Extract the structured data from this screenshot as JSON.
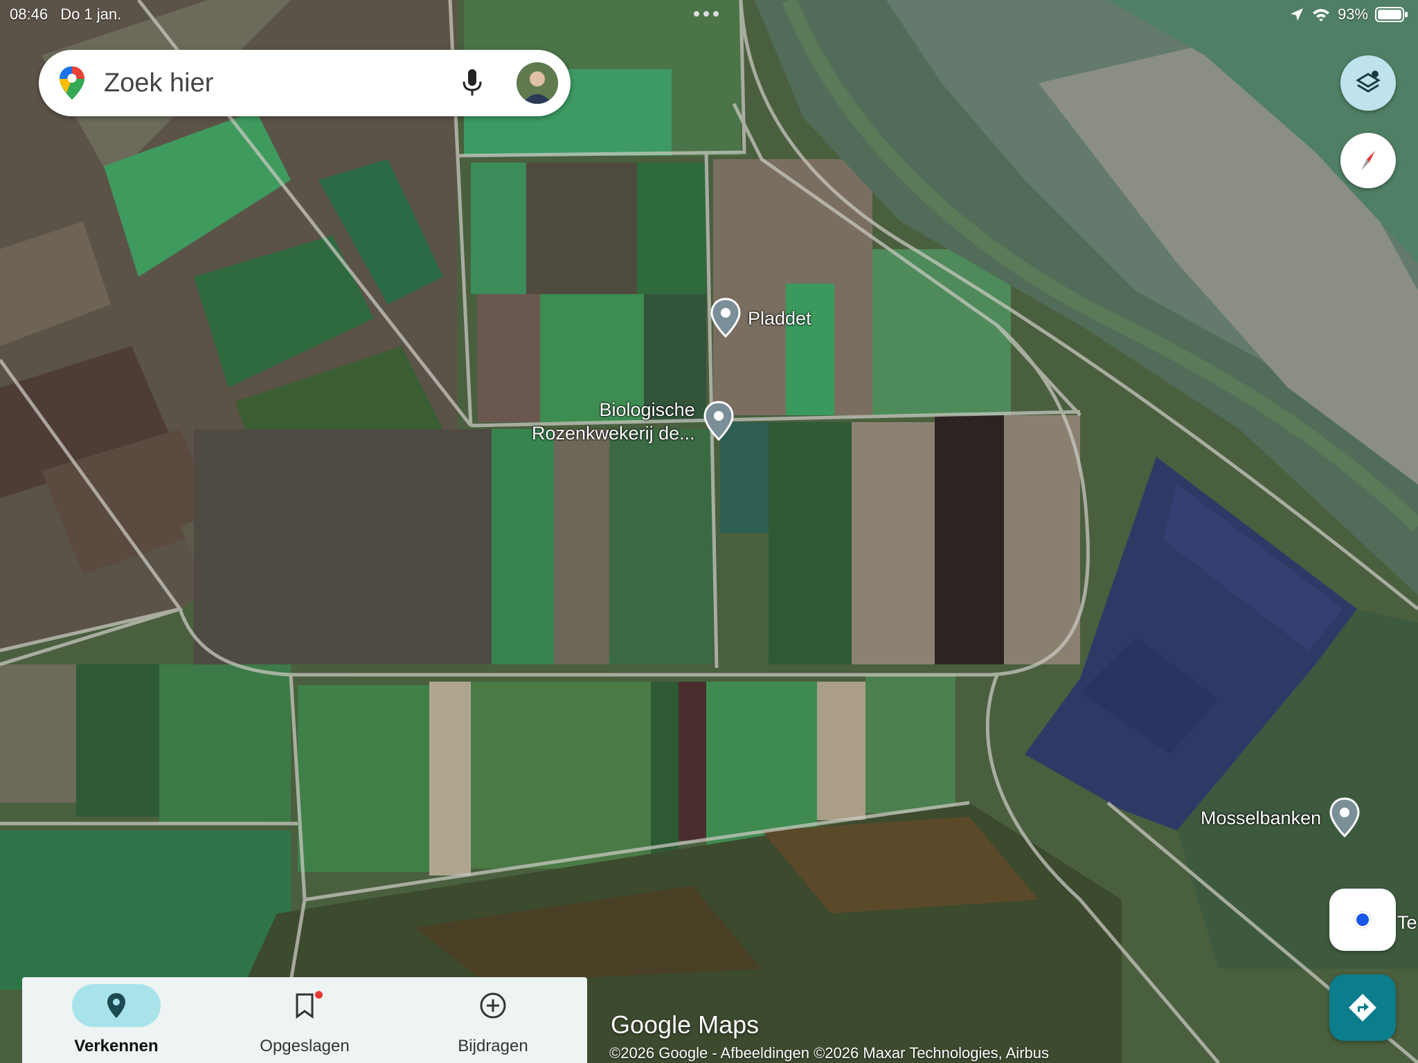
{
  "status_bar": {
    "time": "08:46",
    "date": "Do 1 jan.",
    "battery": "93%"
  },
  "search": {
    "placeholder": "Zoek hier"
  },
  "places": {
    "pladdet": "Pladdet",
    "rozen_line1": "Biologische",
    "rozen_line2": "Rozenkwekerij de...",
    "mosselbanken": "Mosselbanken",
    "edge": "Te"
  },
  "nav": [
    {
      "label": "Verkennen",
      "icon": "explore-pin-icon",
      "active": true
    },
    {
      "label": "Opgeslagen",
      "icon": "bookmark-icon",
      "badge": true
    },
    {
      "label": "Bijdragen",
      "icon": "add-circle-icon"
    }
  ],
  "branding": "Google Maps",
  "copyright": "©2026 Google - Afbeeldingen ©2026 Maxar Technologies, Airbus",
  "colors": {
    "accent": "#0b7d8c",
    "active_pill": "#a9e3ea",
    "layers_button": "#bfe3ec"
  }
}
